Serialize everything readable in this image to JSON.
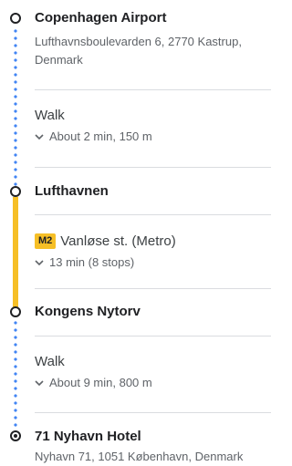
{
  "colors": {
    "walk_dots": "#4285f4",
    "metro_line": "#f6bf26",
    "badge_bg": "#f6bf26",
    "divider": "#dadce0"
  },
  "origin": {
    "name": "Copenhagen Airport",
    "address_line1": "Lufthavnsboulevarden 6, 2770 Kastrup,",
    "address_line2": "Denmark"
  },
  "walk1": {
    "mode": "Walk",
    "detail": "About 2 min, 150 m"
  },
  "stop1": {
    "name": "Lufthavnen"
  },
  "metro": {
    "badge": "M2",
    "line": "Vanløse st. (Metro)",
    "detail": "13 min (8 stops)"
  },
  "stop2": {
    "name": "Kongens Nytorv"
  },
  "walk2": {
    "mode": "Walk",
    "detail": "About 9 min, 800 m"
  },
  "destination": {
    "name": "71 Nyhavn Hotel",
    "address": "Nyhavn 71, 1051 København, Denmark"
  }
}
